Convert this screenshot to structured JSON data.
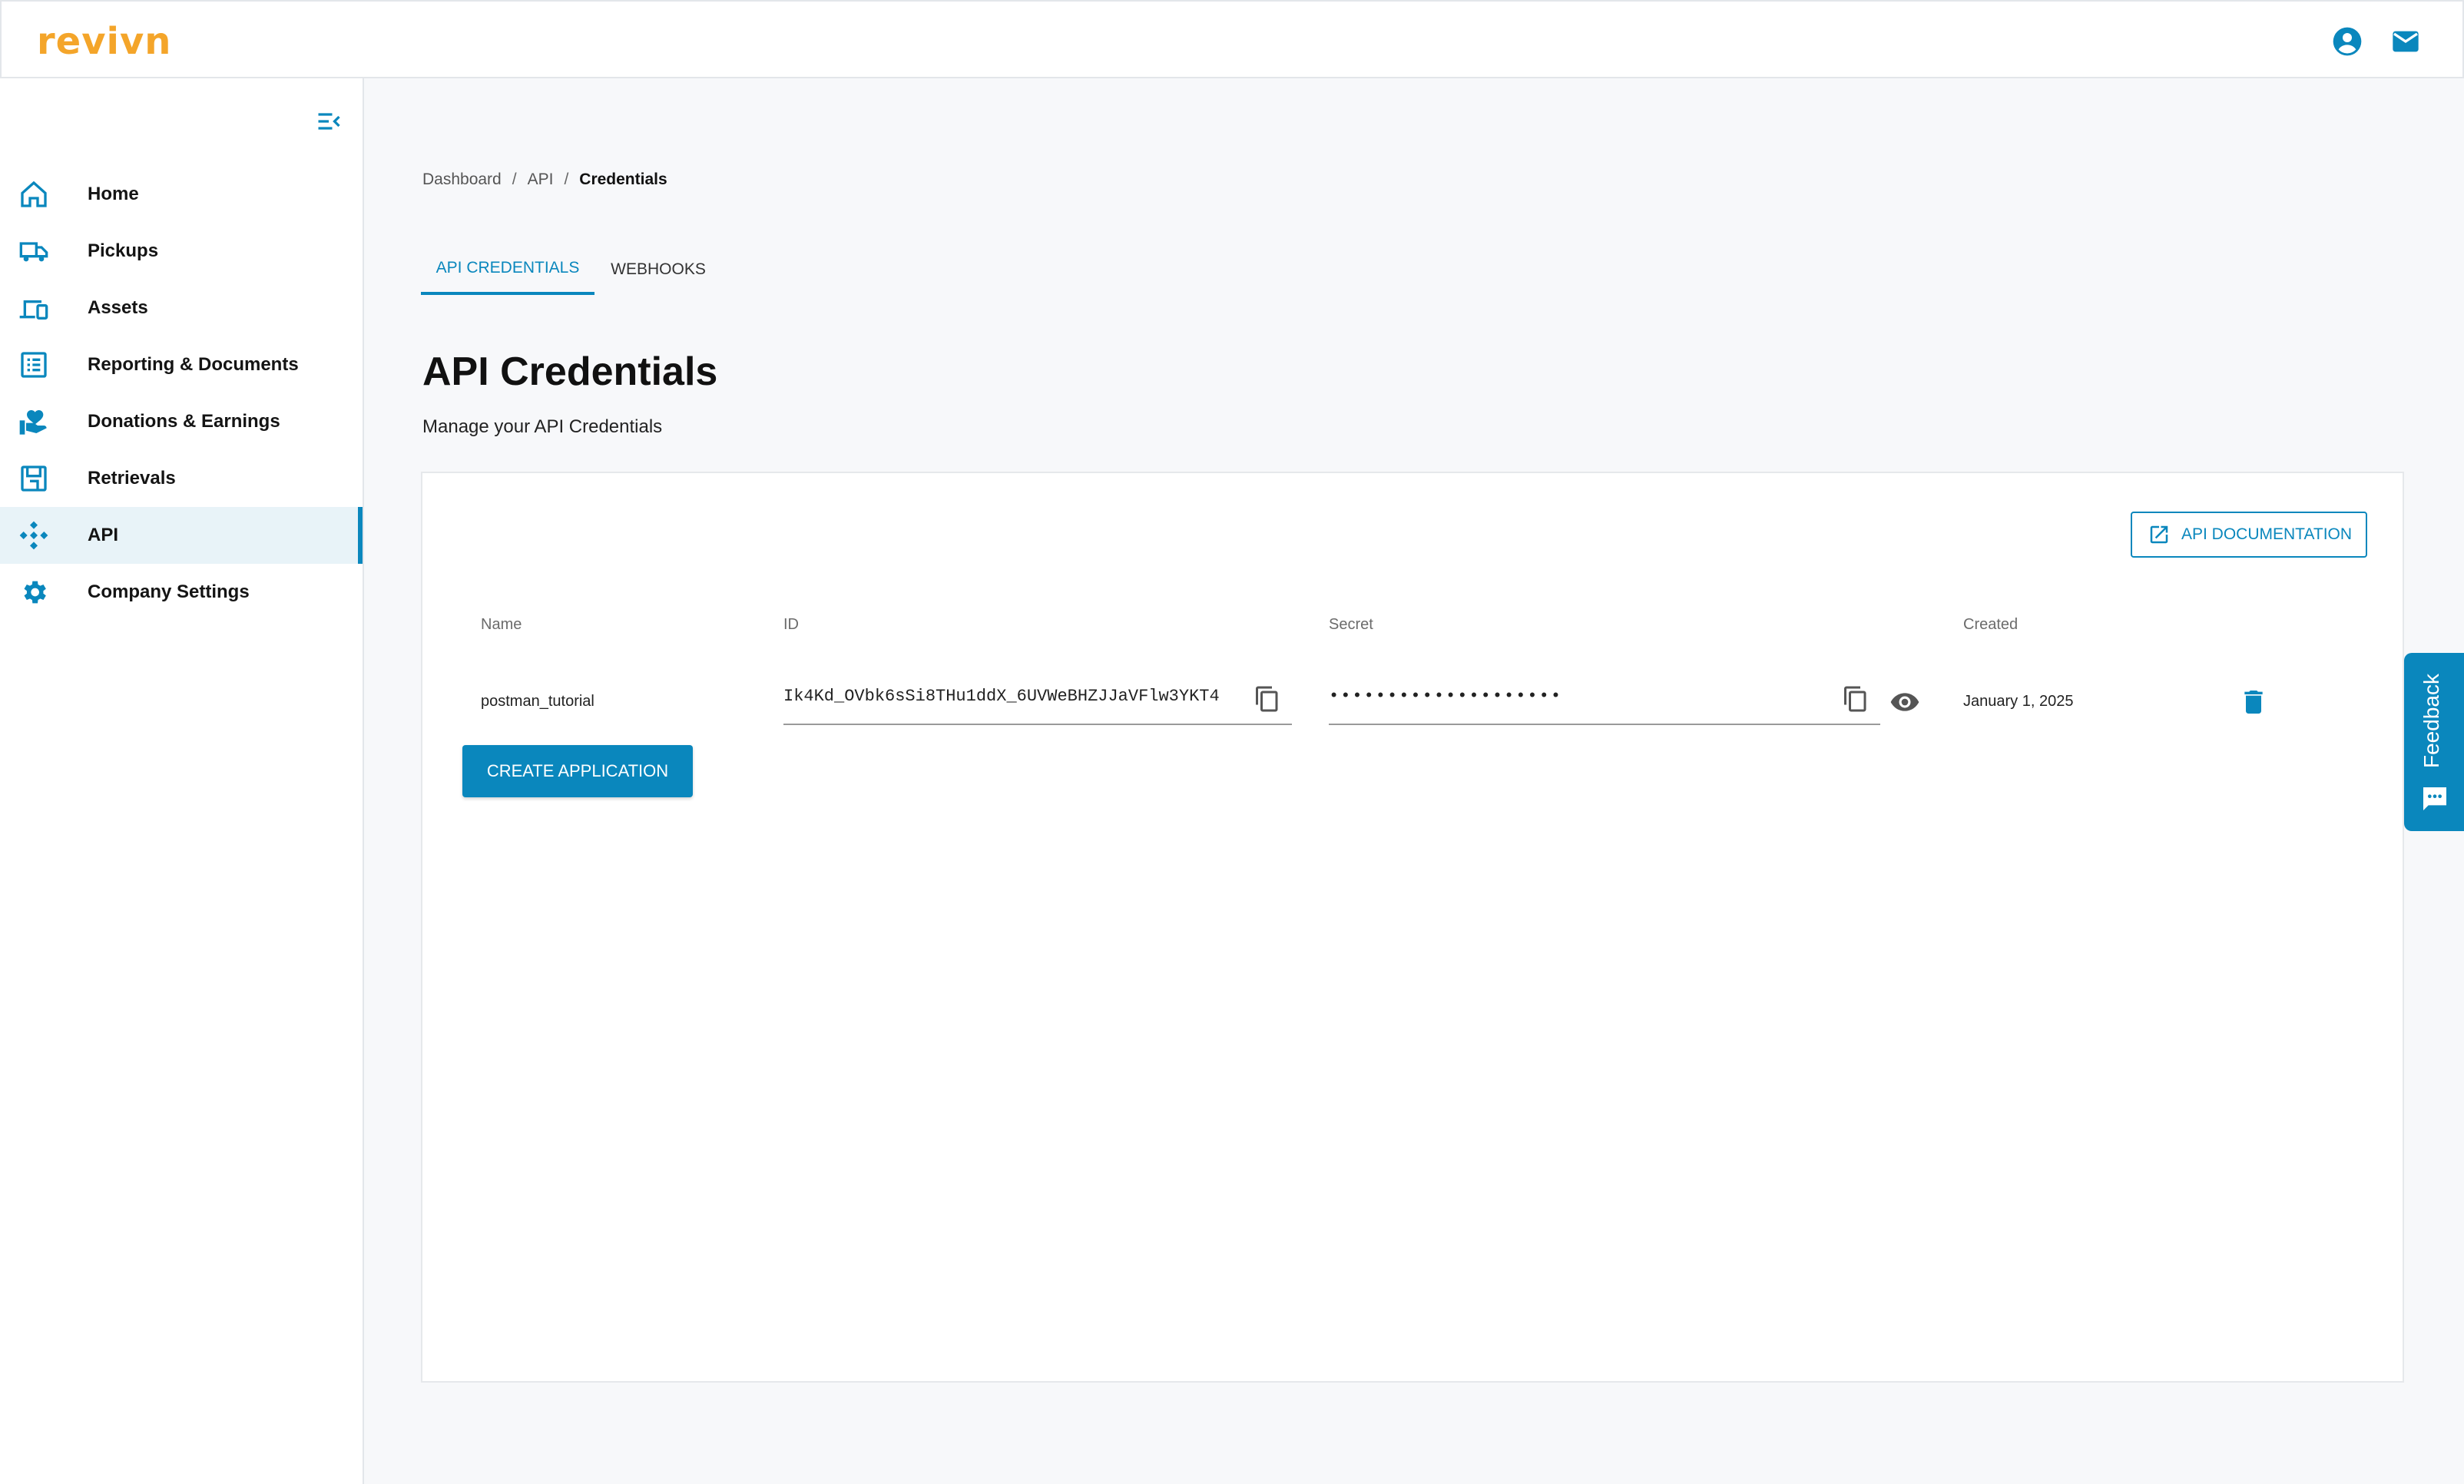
{
  "app": {
    "logo_text": "revivn",
    "brand_color": "#f4a52a",
    "accent_color": "#0a87bd"
  },
  "header": {
    "icons": [
      "account-circle-icon",
      "mail-icon"
    ]
  },
  "sidebar": {
    "items": [
      {
        "label": "Home",
        "icon": "home-icon"
      },
      {
        "label": "Pickups",
        "icon": "truck-icon"
      },
      {
        "label": "Assets",
        "icon": "devices-icon"
      },
      {
        "label": "Reporting & Documents",
        "icon": "list-alt-icon"
      },
      {
        "label": "Donations & Earnings",
        "icon": "volunteer-icon"
      },
      {
        "label": "Retrievals",
        "icon": "save-box-icon"
      },
      {
        "label": "API",
        "icon": "api-icon",
        "active": true
      },
      {
        "label": "Company Settings",
        "icon": "gear-icon"
      }
    ]
  },
  "breadcrumb": {
    "items": [
      "Dashboard",
      "API",
      "Credentials"
    ]
  },
  "tabs": [
    {
      "label": "API CREDENTIALS",
      "active": true
    },
    {
      "label": "WEBHOOKS",
      "active": false
    }
  ],
  "page": {
    "title": "API Credentials",
    "subtitle": "Manage your API Credentials"
  },
  "card": {
    "doc_button_label": "API DOCUMENTATION",
    "columns": [
      "Name",
      "ID",
      "Secret",
      "Created"
    ],
    "rows": [
      {
        "name": "postman_tutorial",
        "id": "Ik4Kd_OVbk6sSi8THu1ddX_6UVWeBHZJJaVFlw3YKT4",
        "secret": "••••••••••••••••••••",
        "created": "January 1, 2025"
      }
    ],
    "create_button_label": "CREATE APPLICATION"
  },
  "feedback": {
    "label": "Feedback"
  }
}
